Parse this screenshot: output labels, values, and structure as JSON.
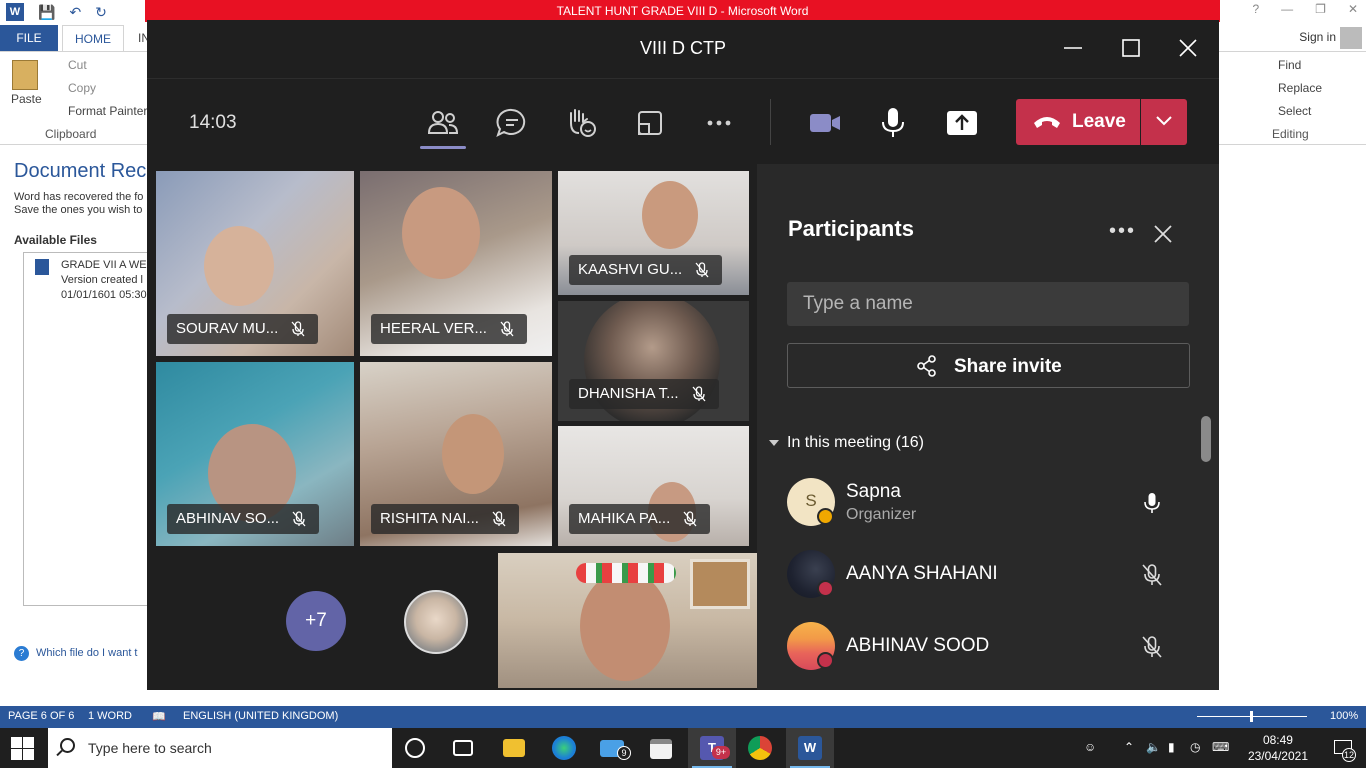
{
  "word": {
    "title": "TALENT HUNT GRADE VIII D  -  Microsoft Word",
    "tabs": {
      "file": "FILE",
      "home": "HOME",
      "insert_partial": "IN"
    },
    "sign_in": "Sign in",
    "clipboard": {
      "paste": "Paste",
      "cut": "Cut",
      "copy": "Copy",
      "format_painter": "Format Painter",
      "group_label": "Clipboard"
    },
    "editing": {
      "find": "Find",
      "replace": "Replace",
      "select": "Select",
      "group_label": "Editing"
    },
    "doc_recovery": {
      "title": "Document Rec",
      "line1": "Word has recovered the fo",
      "line2": "Save the ones you wish to",
      "available_files": "Available Files",
      "file_name": "GRADE VII A WEB",
      "file_version": "Version created l",
      "file_date": "01/01/1601 05:30",
      "help_link": "Which file do I want t"
    },
    "status": {
      "page": "PAGE 6 OF 6",
      "words": "1 WORD",
      "language": "ENGLISH (UNITED KINGDOM)",
      "zoom": "100%"
    }
  },
  "teams": {
    "window_title": "VIII D CTP",
    "call_time": "14:03",
    "leave_label": "Leave",
    "tiles": [
      {
        "name": "SOURAV MU..."
      },
      {
        "name": "HEERAL VER..."
      },
      {
        "name": "KAASHVI GU..."
      },
      {
        "name": "DHANISHA T..."
      },
      {
        "name": "ABHINAV SO..."
      },
      {
        "name": "RISHITA NAI..."
      },
      {
        "name": "MAHIKA PA..."
      }
    ],
    "overflow_count": "+7",
    "panel": {
      "title": "Participants",
      "search_placeholder": "Type a name",
      "share_invite": "Share invite",
      "section_header": "In this meeting (16)",
      "participants": [
        {
          "initial": "S",
          "name": "Sapna",
          "role": "Organizer",
          "mic": "mic-on"
        },
        {
          "name": "AANYA SHAHANI",
          "mic": "mic-off"
        },
        {
          "name": "ABHINAV SOOD",
          "mic": "mic-off"
        }
      ]
    }
  },
  "taskbar": {
    "search_placeholder": "Type here to search",
    "mail_badge": "9",
    "teams_badge": "9+",
    "time": "08:49",
    "date": "23/04/2021",
    "notifications": "12"
  },
  "colors": {
    "word_blue": "#2b579a",
    "word_title_red": "#e81123",
    "teams_bg": "#1f1f1f",
    "teams_panel": "#292929",
    "teams_purple": "#6264a7",
    "leave_red": "#c4314b"
  }
}
